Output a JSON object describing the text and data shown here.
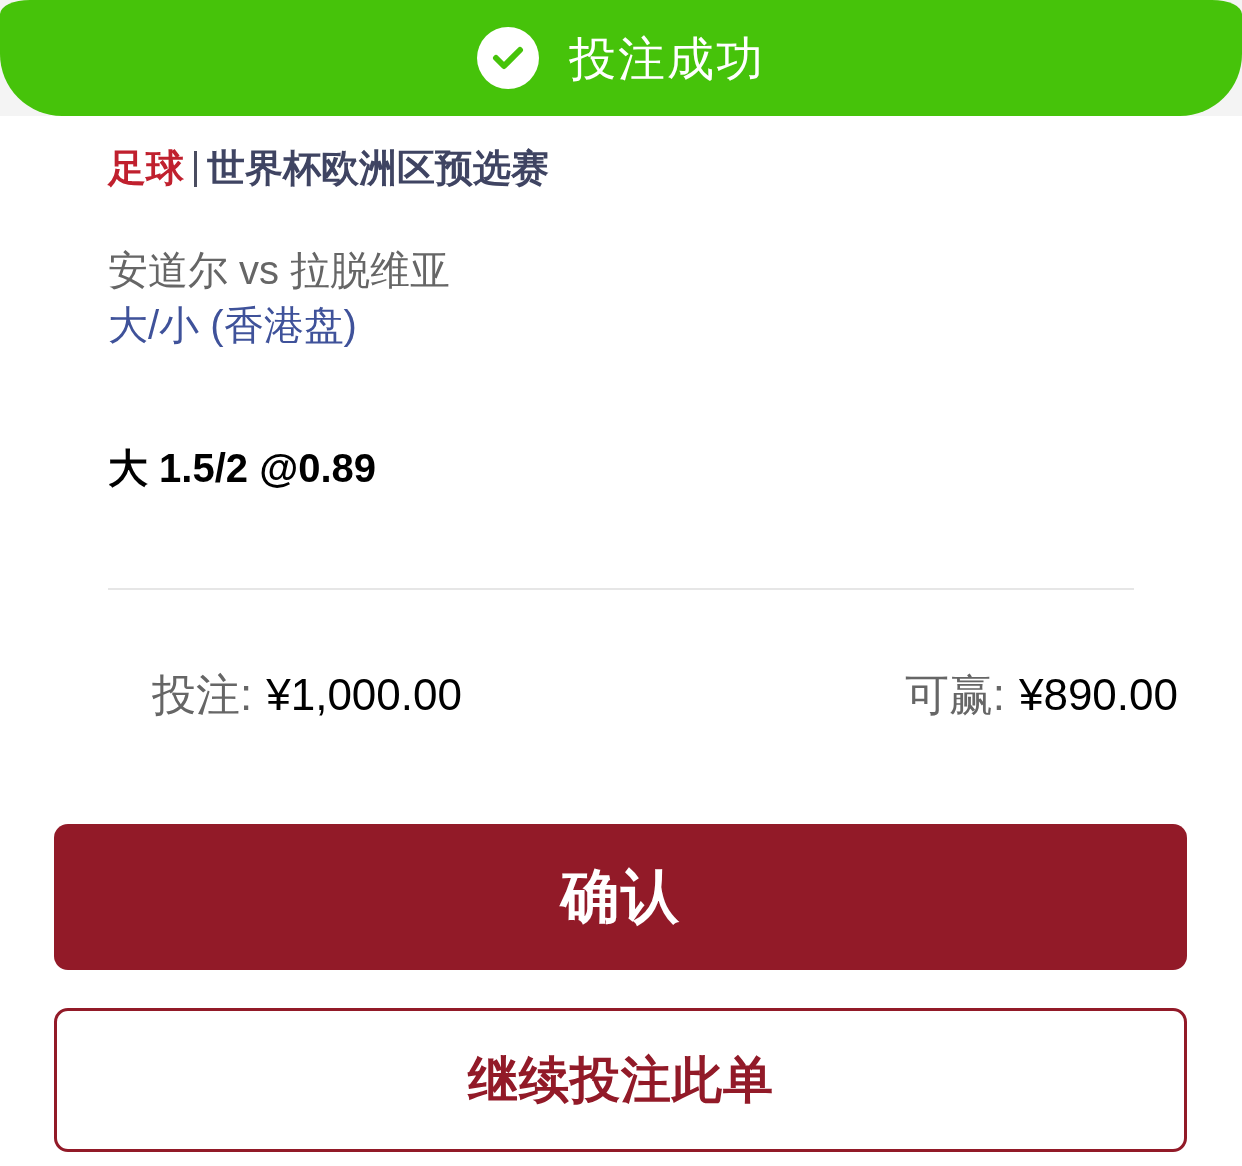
{
  "banner": {
    "message": "投注成功"
  },
  "bet": {
    "sport": "足球",
    "competition": "世界杯欧洲区预选赛",
    "match": "安道尔 vs 拉脱维亚",
    "market": "大/小 (香港盘)",
    "selection": "大 1.5/2 @0.89"
  },
  "summary": {
    "stake_label": "投注:",
    "stake": "¥1,000.00",
    "win_label": "可赢:",
    "win": "¥890.00"
  },
  "buttons": [
    {
      "label": "确认",
      "kind": "primary"
    },
    {
      "label": "继续投注此单",
      "kind": "secondary"
    }
  ]
}
